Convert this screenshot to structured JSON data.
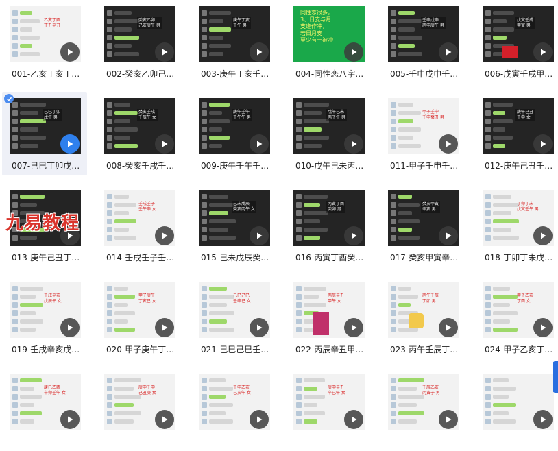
{
  "tiles": [
    {
      "label": "001-乙亥丁亥丁…",
      "style": "light",
      "note": "乙亥丁酉\n丁丑辛丑"
    },
    {
      "label": "002-癸亥乙卯己…",
      "style": "dark",
      "note": "癸亥乙卯\n己亥庚午 男"
    },
    {
      "label": "003-庚午丁亥壬…",
      "style": "dark",
      "note": "庚午丁亥\n壬午 男"
    },
    {
      "label": "004-同性恋八字…",
      "style": "green",
      "note": "同性恋很多，\n3、日支与月\n支逢作冲，\n若日月支\n至少有一被冲"
    },
    {
      "label": "005-壬申戊申壬…",
      "style": "dark",
      "note": "壬申戊申\n丙申庚午 男"
    },
    {
      "label": "006-戊寅壬戌甲…",
      "style": "dark",
      "note": "戊寅壬戌\n甲寅 男"
    },
    {
      "label": "007-己巳丁卯戊…",
      "style": "dark",
      "note": "己巳丁卯\n戊午 男",
      "selected": true
    },
    {
      "label": "008-癸亥壬戌壬…",
      "style": "dark",
      "note": "癸亥壬戌\n壬辰午 女"
    },
    {
      "label": "009-庚午壬午壬…",
      "style": "dark",
      "note": "庚午壬午\n壬午午 男"
    },
    {
      "label": "010-戊午己未丙…",
      "style": "dark",
      "note": "戊午己未\n丙子午 男"
    },
    {
      "label": "011-甲子壬申壬…",
      "style": "light",
      "note": "甲子壬申\n壬申癸丑 男"
    },
    {
      "label": "012-庚午己丑壬…",
      "style": "dark",
      "note": "庚午己丑\n壬申 女"
    },
    {
      "label": "013-庚午己丑丁…",
      "style": "dark",
      "note": ""
    },
    {
      "label": "014-壬戌壬子壬…",
      "style": "light",
      "note": "壬戌壬子\n壬午申 女"
    },
    {
      "label": "015-己未戊辰癸…",
      "style": "dark",
      "note": "己未戊辰\n癸亥丙午 女"
    },
    {
      "label": "016-丙寅丁酉癸…",
      "style": "dark",
      "note": "丙寅丁酉\n癸卯 男"
    },
    {
      "label": "017-癸亥甲寅辛…",
      "style": "dark",
      "note": "癸亥甲寅\n辛亥 男"
    },
    {
      "label": "018-丁卯丁未戊…",
      "style": "light",
      "note": "丁卯丁未\n戊寅壬午 男"
    },
    {
      "label": "019-壬戌辛亥戊…",
      "style": "light",
      "note": "壬戌辛亥\n戊辰午 女"
    },
    {
      "label": "020-甲子庚午丁…",
      "style": "light",
      "note": "甲子庚午\n丁亥巳 女"
    },
    {
      "label": "021-己巳己巳壬…",
      "style": "light",
      "note": "己巳己巳\n壬申己 女"
    },
    {
      "label": "022-丙辰辛丑甲…",
      "style": "light",
      "note": "丙辰辛丑\n甲午 女"
    },
    {
      "label": "023-丙午壬辰丁…",
      "style": "light",
      "note": "丙午壬辰\n丁卯 男"
    },
    {
      "label": "024-甲子乙亥丁…",
      "style": "light",
      "note": "甲子乙亥\n丁酉 女"
    },
    {
      "label": "",
      "style": "light",
      "note": "庚巳乙酉\n辛卯壬午 女"
    },
    {
      "label": "",
      "style": "light",
      "note": "庚申壬申\n己丑庚 女"
    },
    {
      "label": "",
      "style": "light",
      "note": "壬申乙亥\n己亥午 女"
    },
    {
      "label": "",
      "style": "light",
      "note": "庚申辛丑\n辛巳午 女"
    },
    {
      "label": "",
      "style": "light",
      "note": "壬辰乙亥\n丙寅子 男"
    },
    {
      "label": "",
      "style": "light",
      "note": ""
    }
  ],
  "watermark": "九易教程",
  "colors": {
    "accent": "#2f80ed",
    "watermark": "#d9342b"
  }
}
